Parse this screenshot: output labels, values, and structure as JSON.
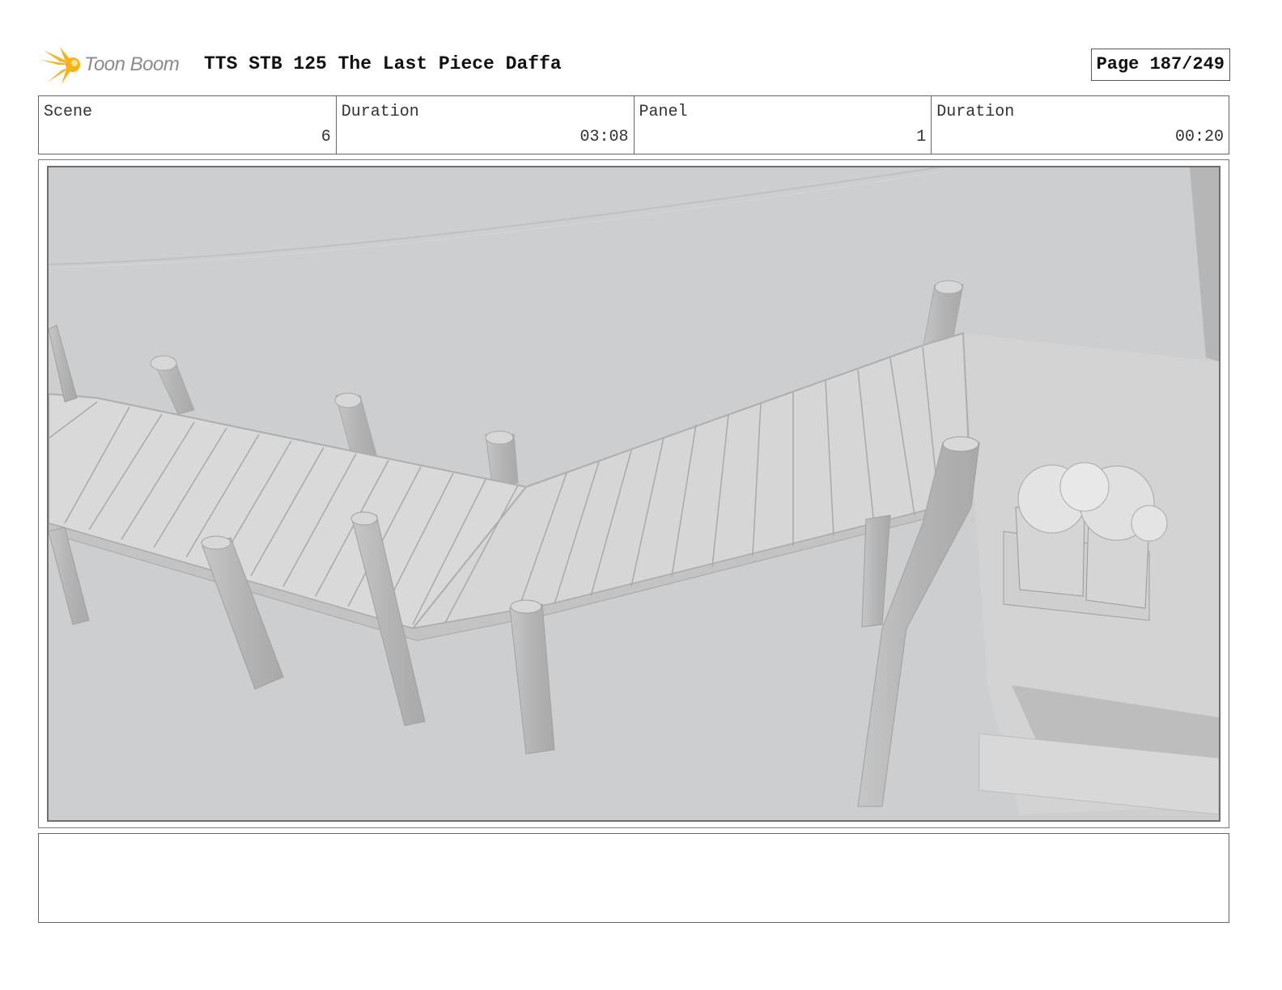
{
  "header": {
    "logo_text": "Toon Boom",
    "title": "TTS STB 125 The Last Piece Daffa",
    "page": "Page 187/249"
  },
  "info": {
    "scene_label": "Scene",
    "scene_value": "6",
    "scene_duration_label": "Duration",
    "scene_duration_value": "03:08",
    "panel_label": "Panel",
    "panel_value": "1",
    "panel_duration_label": "Duration",
    "panel_duration_value": "00:20"
  },
  "colors": {
    "logo_star": "#f5b21b",
    "background": "#cdcdcd",
    "plank": "#d9d9d9",
    "post": "#bdbdbd"
  },
  "notes": {
    "text": ""
  }
}
